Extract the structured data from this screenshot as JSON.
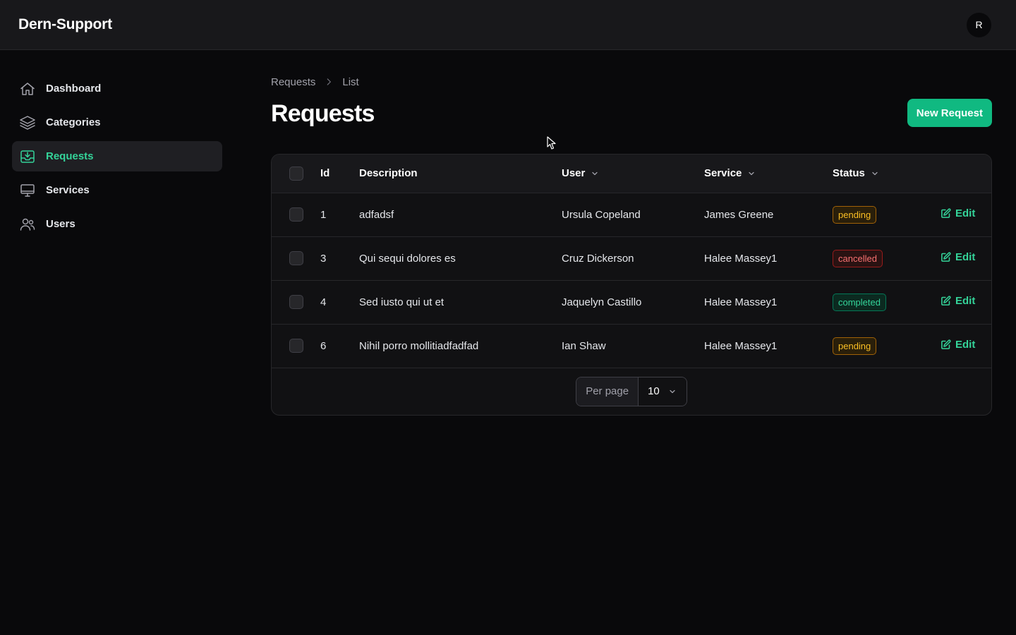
{
  "app": {
    "brand": "Dern-Support",
    "avatar_initial": "R"
  },
  "sidebar": {
    "items": [
      {
        "label": "Dashboard",
        "icon": "home-icon",
        "active": false
      },
      {
        "label": "Categories",
        "icon": "layers-icon",
        "active": false
      },
      {
        "label": "Requests",
        "icon": "inbox-icon",
        "active": true
      },
      {
        "label": "Services",
        "icon": "monitor-icon",
        "active": false
      },
      {
        "label": "Users",
        "icon": "users-icon",
        "active": false
      }
    ]
  },
  "breadcrumb": {
    "items": [
      "Requests",
      "List"
    ]
  },
  "page": {
    "title": "Requests",
    "new_button_label": "New Request"
  },
  "table": {
    "columns": {
      "id": "Id",
      "description": "Description",
      "user": "User",
      "service": "Service",
      "status": "Status"
    },
    "rows": [
      {
        "id": "1",
        "description": "adfadsf",
        "user": "Ursula Copeland",
        "service": "James Greene",
        "status": "pending",
        "action": "Edit"
      },
      {
        "id": "3",
        "description": "Qui sequi dolores es",
        "user": "Cruz Dickerson",
        "service": "Halee Massey1",
        "status": "cancelled",
        "action": "Edit"
      },
      {
        "id": "4",
        "description": "Sed iusto qui ut et",
        "user": "Jaquelyn Castillo",
        "service": "Halee Massey1",
        "status": "completed",
        "action": "Edit"
      },
      {
        "id": "6",
        "description": "Nihil porro mollitiadfadfad",
        "user": "Ian Shaw",
        "service": "Halee Massey1",
        "status": "pending",
        "action": "Edit"
      }
    ]
  },
  "pagination": {
    "per_page_label": "Per page",
    "per_page_value": "10"
  },
  "colors": {
    "accent": "#10b981",
    "pending": "#fbbf24",
    "cancelled": "#f87171",
    "completed": "#34d399"
  }
}
